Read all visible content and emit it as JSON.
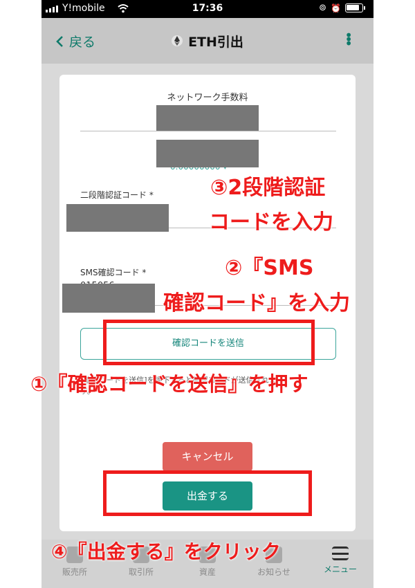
{
  "status_bar": {
    "carrier": "Y!mobile",
    "time": "17:36"
  },
  "header": {
    "back_label": "戻る",
    "title": "ETH引出"
  },
  "modal": {
    "network_fee_label": "ネットワーク手数料",
    "amount_fragment": "0.00000000 ▾",
    "two_factor_label": "二段階認証コード *",
    "sms_label": "SMS確認コード *",
    "sms_value_fragment": "015056",
    "send_code_button": "確認コードを送信",
    "note_line1_fragment": "[確認コードを送信]を押下すると確認コードが送信されま",
    "note_line2": "す。",
    "cancel_button": "キャンセル",
    "withdraw_button": "出金する"
  },
  "tab_bar": [
    {
      "label": "販売所",
      "icon": "sales-icon"
    },
    {
      "label": "取引所",
      "icon": "exchange-icon"
    },
    {
      "label": "資産",
      "icon": "assets-icon"
    },
    {
      "label": "お知らせ",
      "icon": "notification-icon"
    },
    {
      "label": "メニュー",
      "icon": "menu-icon"
    }
  ],
  "annotations": {
    "step3_line1": "③2段階認証",
    "step3_line2": "コードを入力",
    "step2_line1": "②『SMS",
    "step2_line2": "確認コード』を入力",
    "step1": "①『確認コードを送信』を押す",
    "step4": "④『出金する』をクリック",
    "color": "#ee1c1c"
  },
  "colors": {
    "accent": "#1a9484",
    "cancel": "#e0625c",
    "header_bg": "#c6c6c6"
  }
}
